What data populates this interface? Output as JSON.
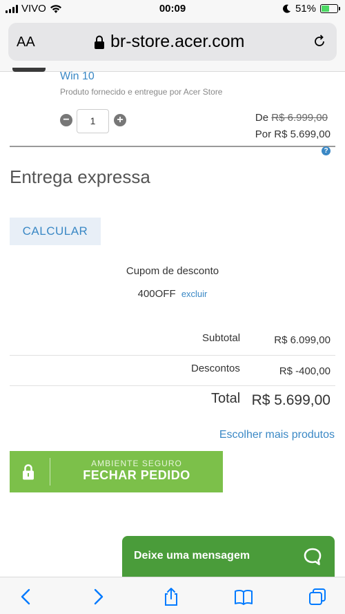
{
  "status_bar": {
    "carrier": "VIVO",
    "time": "00:09",
    "battery_percent": "51%",
    "battery_level": 0.51
  },
  "browser": {
    "text_size_label": "AA",
    "url": "br-store.acer.com"
  },
  "product": {
    "name_fragment": "Win 10",
    "supplier": "Produto fornecido e entregue por Acer Store",
    "quantity": "1",
    "price_from_prefix": "De",
    "price_from": "R$ 6.999,00",
    "price_now": "Por R$ 5.699,00"
  },
  "shipping": {
    "title": "Entrega expressa",
    "calc_button": "CALCULAR"
  },
  "coupon": {
    "label": "Cupom de desconto",
    "code": "400OFF",
    "remove_label": "excluir"
  },
  "summary": {
    "subtotal_label": "Subtotal",
    "subtotal_value": "R$ 6.099,00",
    "discount_label": "Descontos",
    "discount_value": "R$ -400,00",
    "total_label": "Total",
    "total_value": "R$ 5.699,00"
  },
  "more_products_link": "Escolher mais produtos",
  "checkout": {
    "secure_label": "AMBIENTE SEGURO",
    "button_label": "FECHAR PEDIDO"
  },
  "chat": {
    "label": "Deixe uma mensagem"
  },
  "colors": {
    "link_blue": "#3a88c5",
    "checkout_green": "#7cc04a",
    "chat_green": "#4a9c3a",
    "ios_blue": "#007aff"
  },
  "icons": [
    "wifi-icon",
    "moon-icon",
    "battery-icon",
    "lock-icon",
    "reload-icon",
    "minus-icon",
    "plus-icon",
    "help-icon",
    "padlock-icon",
    "chat-bubble-icon",
    "back-icon",
    "forward-icon",
    "share-icon",
    "bookmarks-icon",
    "tabs-icon"
  ]
}
